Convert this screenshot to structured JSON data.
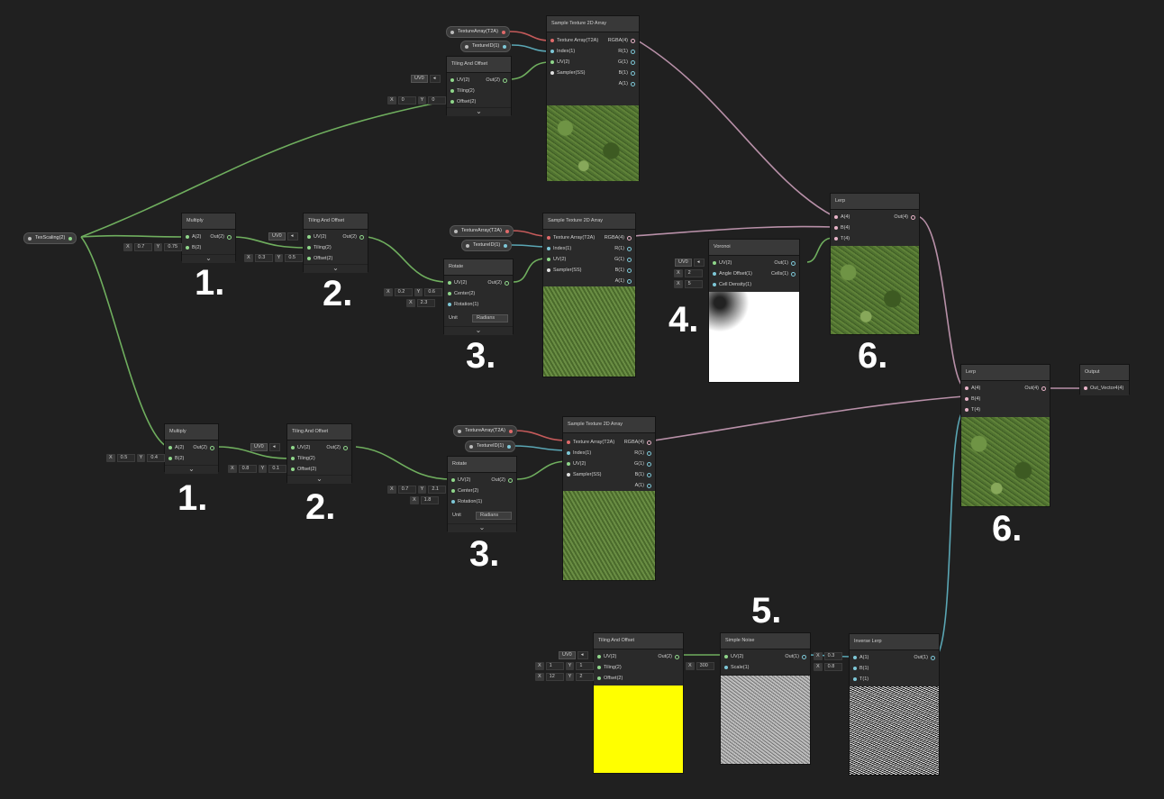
{
  "ports": {
    "a2": "A(2)",
    "b2": "B(2)",
    "out2": "Out(2)",
    "uv2": "UV(2)",
    "tiling2": "Tiling(2)",
    "offset2": "Offset(2)",
    "center2": "Center(2)",
    "rotation1": "Rotation(1)",
    "tex_array": "Texture Array(T2A)",
    "index1": "Index(1)",
    "sampler": "Sampler(SS)",
    "rgba4": "RGBA(4)",
    "r1": "R(1)",
    "g1": "G(1)",
    "b1": "B(1)",
    "a1": "A(1)",
    "a4": "A(4)",
    "b4": "B(4)",
    "t4": "T(4)",
    "out4": "Out(4)",
    "angle_offset": "Angle Offset(1)",
    "cell_density": "Cell Density(1)",
    "out1": "Out(1)",
    "cells1": "Cells(1)",
    "scale1": "Scale(1)",
    "a1i": "A(1)",
    "b1i": "B(1)",
    "t1": "T(1)",
    "out_vector": "Out_Vector4(4)"
  },
  "titles": {
    "multiply": "Multiply",
    "tiling_offset": "Tiling And Offset",
    "rotate": "Rotate",
    "sample_tex": "Sample Texture 2D Array",
    "voronoi": "Voronoi",
    "lerp": "Lerp",
    "simple_noise": "Simple Noise",
    "inverse_lerp": "Inverse Lerp",
    "output": "Output"
  },
  "properties": {
    "tex_scaling": "TexScaling(2)",
    "texture_array": "TextureArray(T2A)",
    "texture_id": "TextureID(1)"
  },
  "controls": {
    "uv0": "UV0",
    "unit": "Unit",
    "radians": "Radians",
    "x": "X",
    "y": "Y",
    "chevron": "⌄",
    "top_offset": [
      "0",
      "0"
    ],
    "mul1_b": [
      "0.7",
      "0.75"
    ],
    "tile1_off": [
      "0.3",
      "0.5"
    ],
    "rot1_center": [
      "0.2",
      "0.6"
    ],
    "rot1_rot": "2.3",
    "mul2_b": [
      "0.5",
      "0.4"
    ],
    "tile2_off": [
      "0.8",
      "0.1"
    ],
    "rot2_center": [
      "0.7",
      "2.1"
    ],
    "rot2_rot": "1.8",
    "vor_angle": "2",
    "vor_density": "5",
    "tile3_tiling": [
      "1",
      "1"
    ],
    "tile3_offset": [
      "12",
      "2"
    ],
    "noise_scale": "300",
    "inv_a": "0.3",
    "inv_b": "0.8"
  },
  "labels": {
    "n1": "1.",
    "n2": "2.",
    "n3": "3.",
    "n4": "4.",
    "n5": "5.",
    "n6": "6."
  },
  "colors": {
    "green_wire": "#6fae5e",
    "blue_wire": "#5aa6b4",
    "red_wire": "#c45a5a",
    "pink_wire": "#b890a8",
    "bg": "#202020"
  }
}
